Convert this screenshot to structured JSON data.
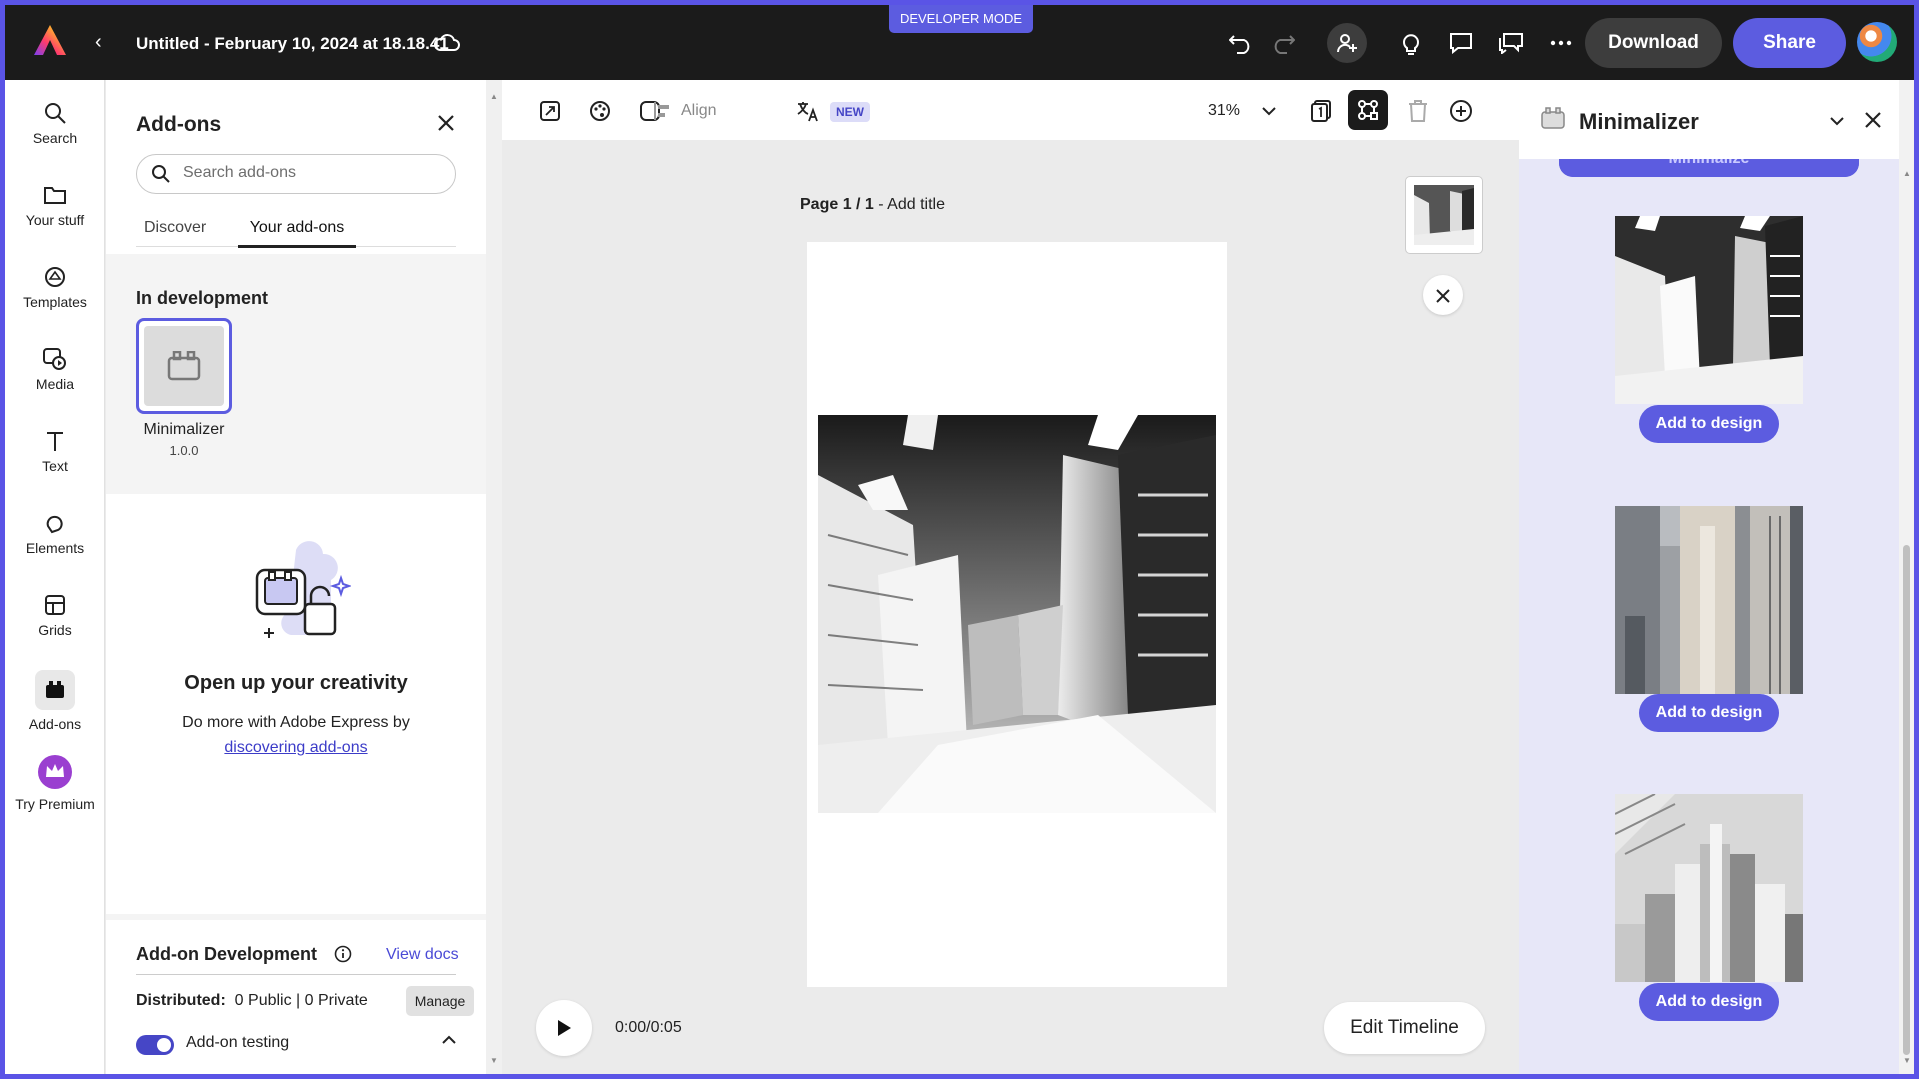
{
  "header": {
    "doc_title": "Untitled - February 10, 2024 at 18.18.41",
    "developer_badge": "DEVELOPER MODE",
    "download_label": "Download",
    "share_label": "Share"
  },
  "rail": {
    "items": [
      {
        "label": "Search",
        "icon": "search-icon"
      },
      {
        "label": "Your stuff",
        "icon": "folder-icon"
      },
      {
        "label": "Templates",
        "icon": "templates-icon"
      },
      {
        "label": "Media",
        "icon": "media-icon"
      },
      {
        "label": "Text",
        "icon": "text-icon"
      },
      {
        "label": "Elements",
        "icon": "elements-icon"
      },
      {
        "label": "Grids",
        "icon": "grids-icon"
      },
      {
        "label": "Add-ons",
        "icon": "addons-icon"
      },
      {
        "label": "Try Premium",
        "icon": "crown-icon"
      }
    ]
  },
  "addons_panel": {
    "title": "Add-ons",
    "search_placeholder": "Search add-ons",
    "tabs": [
      "Discover",
      "Your add-ons"
    ],
    "active_tab": "Your add-ons",
    "in_development_label": "In development",
    "addon": {
      "name": "Minimalizer",
      "version": "1.0.0"
    },
    "promo": {
      "title": "Open up your creativity",
      "text": "Do more with Adobe Express by",
      "link": "discovering add-ons"
    },
    "development": {
      "title": "Add-on Development",
      "docs_link": "View docs",
      "distributed_label": "Distributed:",
      "distributed_value": "0 Public | 0 Private",
      "manage_label": "Manage",
      "testing_label": "Add-on testing"
    }
  },
  "toolbar": {
    "align_label": "Align",
    "new_badge": "NEW",
    "zoom": "31%"
  },
  "canvas": {
    "page_number": "Page 1 / 1",
    "page_title_placeholder": "- Add title",
    "time": "0:00/0:05",
    "edit_timeline_label": "Edit Timeline"
  },
  "right_panel": {
    "title": "Minimalizer",
    "minimize_label": "Minimalize",
    "add_to_design_label": "Add to design",
    "results": [
      "result-1",
      "result-2",
      "result-3"
    ]
  },
  "colors": {
    "accent": "#5c5ce0",
    "header_bg": "#1b1b1b",
    "frame_border": "#5a54e6",
    "right_panel_bg": "#e7e7f8"
  }
}
